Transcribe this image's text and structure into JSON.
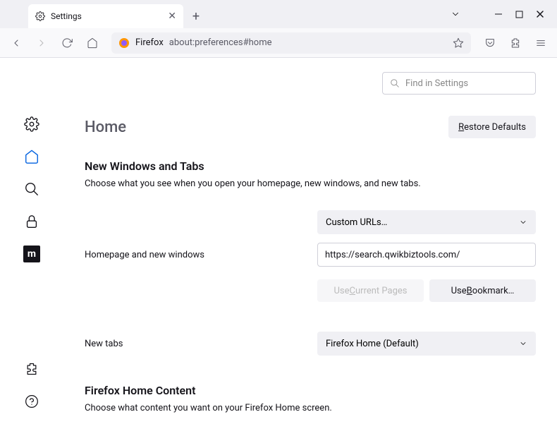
{
  "tab": {
    "title": "Settings"
  },
  "urlbar": {
    "label": "Firefox",
    "url": "about:preferences#home"
  },
  "search": {
    "placeholder": "Find in Settings"
  },
  "page": {
    "title": "Home"
  },
  "buttons": {
    "restore_defaults": "Restore Defaults",
    "use_current": "Use Current Pages",
    "use_bookmark": "Use Bookmark…"
  },
  "section1": {
    "title": "New Windows and Tabs",
    "desc": "Choose what you see when you open your homepage, new windows, and new tabs."
  },
  "form": {
    "homepage_label": "Homepage and new windows",
    "homepage_select": "Custom URLs…",
    "homepage_url": "https://search.qwikbiztools.com/",
    "newtabs_label": "New tabs",
    "newtabs_select": "Firefox Home (Default)"
  },
  "section2": {
    "title": "Firefox Home Content",
    "desc": "Choose what content you want on your Firefox Home screen."
  }
}
